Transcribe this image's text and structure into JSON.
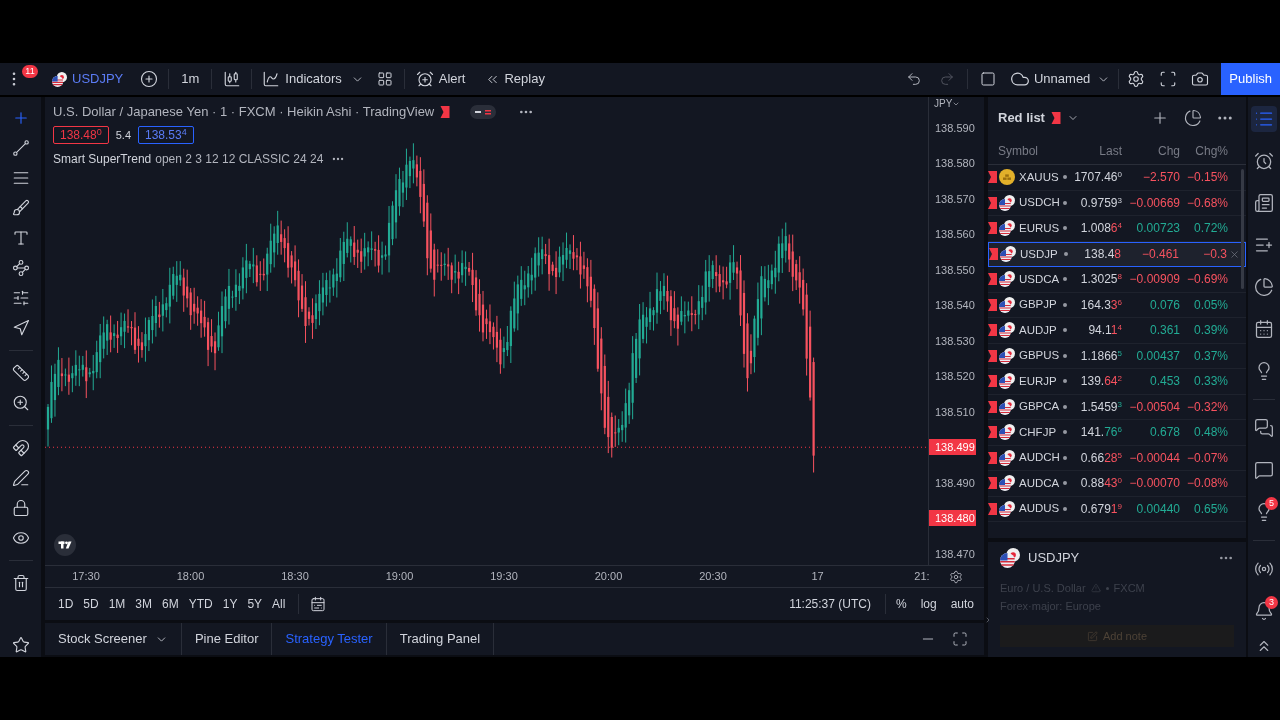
{
  "toolbar": {
    "notifications": "11",
    "symbol": "USDJPY",
    "interval": "1m",
    "indicators": "Indicators",
    "alert": "Alert",
    "replay": "Replay",
    "undo": {
      "disabled": false
    },
    "redo": {
      "disabled": true
    },
    "layout_name": "Unnamed",
    "publish": "Publish"
  },
  "left_toolbar": {
    "groups": [
      {
        "items": [
          {
            "selected": true
          },
          {
            "selected": false
          },
          {
            "selected": false
          },
          {
            "selected": false
          },
          {
            "selected": false
          },
          {
            "selected": false
          },
          {
            "selected": false
          },
          {
            "selected": false
          }
        ]
      },
      {
        "items": [
          {
            "selected": false
          },
          {
            "selected": false
          }
        ]
      },
      {
        "items": [
          {
            "selected": false
          },
          {
            "selected": false
          },
          {
            "selected": false
          },
          {
            "selected": false
          }
        ]
      },
      {
        "items": [
          {
            "selected": false
          }
        ]
      },
      {
        "items": [
          {
            "selected": false
          }
        ]
      }
    ]
  },
  "chart": {
    "title": "U.S. Dollar / Japanese Yen · 1 · FXCM · Heikin Ashi · TradingView",
    "bid": "138.48$^{0}$",
    "spread": "5.4",
    "ask": "138.53$^{4}$",
    "indicator": {
      "name": "Smart SuperTrend",
      "params": "open 2 3 12 12 CLASSIC 24 24"
    },
    "currency": "JPY",
    "price_labels": [
      {
        "text": "138.590",
        "marker": false
      },
      {
        "text": "138.580",
        "marker": false
      },
      {
        "text": "138.570",
        "marker": false
      },
      {
        "text": "138.560",
        "marker": false
      },
      {
        "text": "138.550",
        "marker": false
      },
      {
        "text": "138.540",
        "marker": false
      },
      {
        "text": "138.530",
        "marker": false
      },
      {
        "text": "138.520",
        "marker": false
      },
      {
        "text": "138.510",
        "marker": false
      },
      {
        "text": "138.499",
        "marker": true
      },
      {
        "text": "138.490",
        "marker": false
      },
      {
        "text": "138.480",
        "marker": true
      },
      {
        "text": "138.470",
        "marker": false
      }
    ],
    "time_labels": [
      "17:30",
      "18:00",
      "18:30",
      "19:00",
      "19:30",
      "20:00",
      "20:30",
      "17",
      "21:"
    ]
  },
  "range_bar": {
    "ranges": [
      "1D",
      "5D",
      "1M",
      "3M",
      "6M",
      "YTD",
      "1Y",
      "5Y",
      "All"
    ],
    "clock": "11:25:37 (UTC)",
    "scale_options": [
      "%",
      "log",
      "auto"
    ]
  },
  "bottom_tabs": [
    {
      "label": "Stock Screener",
      "selected": false,
      "dropdown": true
    },
    {
      "label": "Pine Editor",
      "selected": false,
      "dropdown": false
    },
    {
      "label": "Strategy Tester",
      "selected": true,
      "dropdown": false
    },
    {
      "label": "Trading Panel",
      "selected": false,
      "dropdown": false
    }
  ],
  "watchlist": {
    "title": "Red list",
    "columns": [
      "Symbol",
      "Last",
      "Chg",
      "Chg%"
    ],
    "rows": [
      {
        "kind": "coin",
        "symbol": "XAUUS",
        "last": "1707.46",
        "pip": "0",
        "chg": "−2.570",
        "chg_pct": "−0.15%",
        "gain": false,
        "selected": false
      },
      {
        "kind": "flags",
        "symbol": "USDCH",
        "last": "0.9759",
        "pip": "3",
        "chg": "−0.00669",
        "chg_pct": "−0.68%",
        "gain": false,
        "selected": false
      },
      {
        "kind": "flags",
        "symbol": "EURUS",
        "last": "1.008",
        "tick": "6",
        "pip": "4",
        "tick_rising": false,
        "chg": "0.00723",
        "chg_pct": "0.72%",
        "gain": true,
        "selected": false
      },
      {
        "kind": "flags",
        "symbol": "USDJP",
        "last": "138.4",
        "tick": "8",
        "tick_rising": false,
        "chg": "−0.461",
        "chg_pct": "−0.3",
        "gain": false,
        "selected": true
      },
      {
        "kind": "flags",
        "symbol": "USDCA",
        "last": "1.3025",
        "pip": "8",
        "tick_rising": false,
        "chg": "−0.00909",
        "chg_pct": "−0.69%",
        "gain": false,
        "selected": false
      },
      {
        "kind": "flags",
        "symbol": "GBPJP",
        "last": "164.3",
        "tick": "3",
        "pip": "6",
        "tick_rising": false,
        "chg": "0.076",
        "chg_pct": "0.05%",
        "gain": true,
        "selected": false
      },
      {
        "kind": "flags",
        "symbol": "AUDJP",
        "last": "94.1",
        "tick": "1",
        "pip": "4",
        "tick_rising": false,
        "chg": "0.361",
        "chg_pct": "0.39%",
        "gain": true,
        "selected": false
      },
      {
        "kind": "flags",
        "symbol": "GBPUS",
        "last": "1.1866",
        "pip": "5",
        "tick_rising": true,
        "chg": "0.00437",
        "chg_pct": "0.37%",
        "gain": true,
        "selected": false
      },
      {
        "kind": "flags",
        "symbol": "EURJP",
        "last": "139.",
        "tick": "64",
        "pip": "2",
        "tick_rising": false,
        "chg": "0.453",
        "chg_pct": "0.33%",
        "gain": true,
        "selected": false
      },
      {
        "kind": "flags",
        "symbol": "GBPCA",
        "last": "1.5459",
        "pip": "3",
        "tick_rising": true,
        "chg": "−0.00504",
        "chg_pct": "−0.32%",
        "gain": false,
        "selected": false
      },
      {
        "kind": "flags",
        "symbol": "CHFJP",
        "last": "141.",
        "tick": "76",
        "pip": "6",
        "tick_rising": true,
        "chg": "0.678",
        "chg_pct": "0.48%",
        "gain": true,
        "selected": false
      },
      {
        "kind": "flags",
        "symbol": "AUDCH",
        "last": "0.66",
        "tick": "28",
        "pip": "5",
        "tick_rising": false,
        "chg": "−0.00044",
        "chg_pct": "−0.07%",
        "gain": false,
        "selected": false
      },
      {
        "kind": "flags",
        "symbol": "AUDCA",
        "last": "0.88",
        "tick": "43",
        "pip": "0",
        "tick_rising": false,
        "chg": "−0.00070",
        "chg_pct": "−0.08%",
        "gain": false,
        "selected": false
      },
      {
        "kind": "flags",
        "symbol": "AUDUS",
        "last": "0.679",
        "tick": "1",
        "pip": "9",
        "tick_rising": false,
        "chg": "0.00440",
        "chg_pct": "0.65%",
        "gain": true,
        "selected": false
      }
    ]
  },
  "details": {
    "symbol": "USDJPY",
    "description": "Euro / U.S. Dollar",
    "exchange": "FXCM",
    "category": "Forex·major: Europe",
    "add_note": "Add note"
  },
  "right_sidebar": {
    "groups": [
      {
        "items": [
          {
            "selected": true
          },
          {
            "selected": false
          },
          {
            "selected": false
          },
          {
            "selected": false
          },
          {
            "selected": false
          },
          {
            "selected": false
          },
          {
            "selected": false
          }
        ]
      },
      {
        "items": [
          {
            "selected": false
          },
          {
            "selected": false
          },
          {
            "selected": false,
            "badge": "5"
          }
        ]
      },
      {
        "items": [
          {
            "selected": false
          },
          {
            "selected": false,
            "badge": "3"
          }
        ]
      }
    ]
  }
}
